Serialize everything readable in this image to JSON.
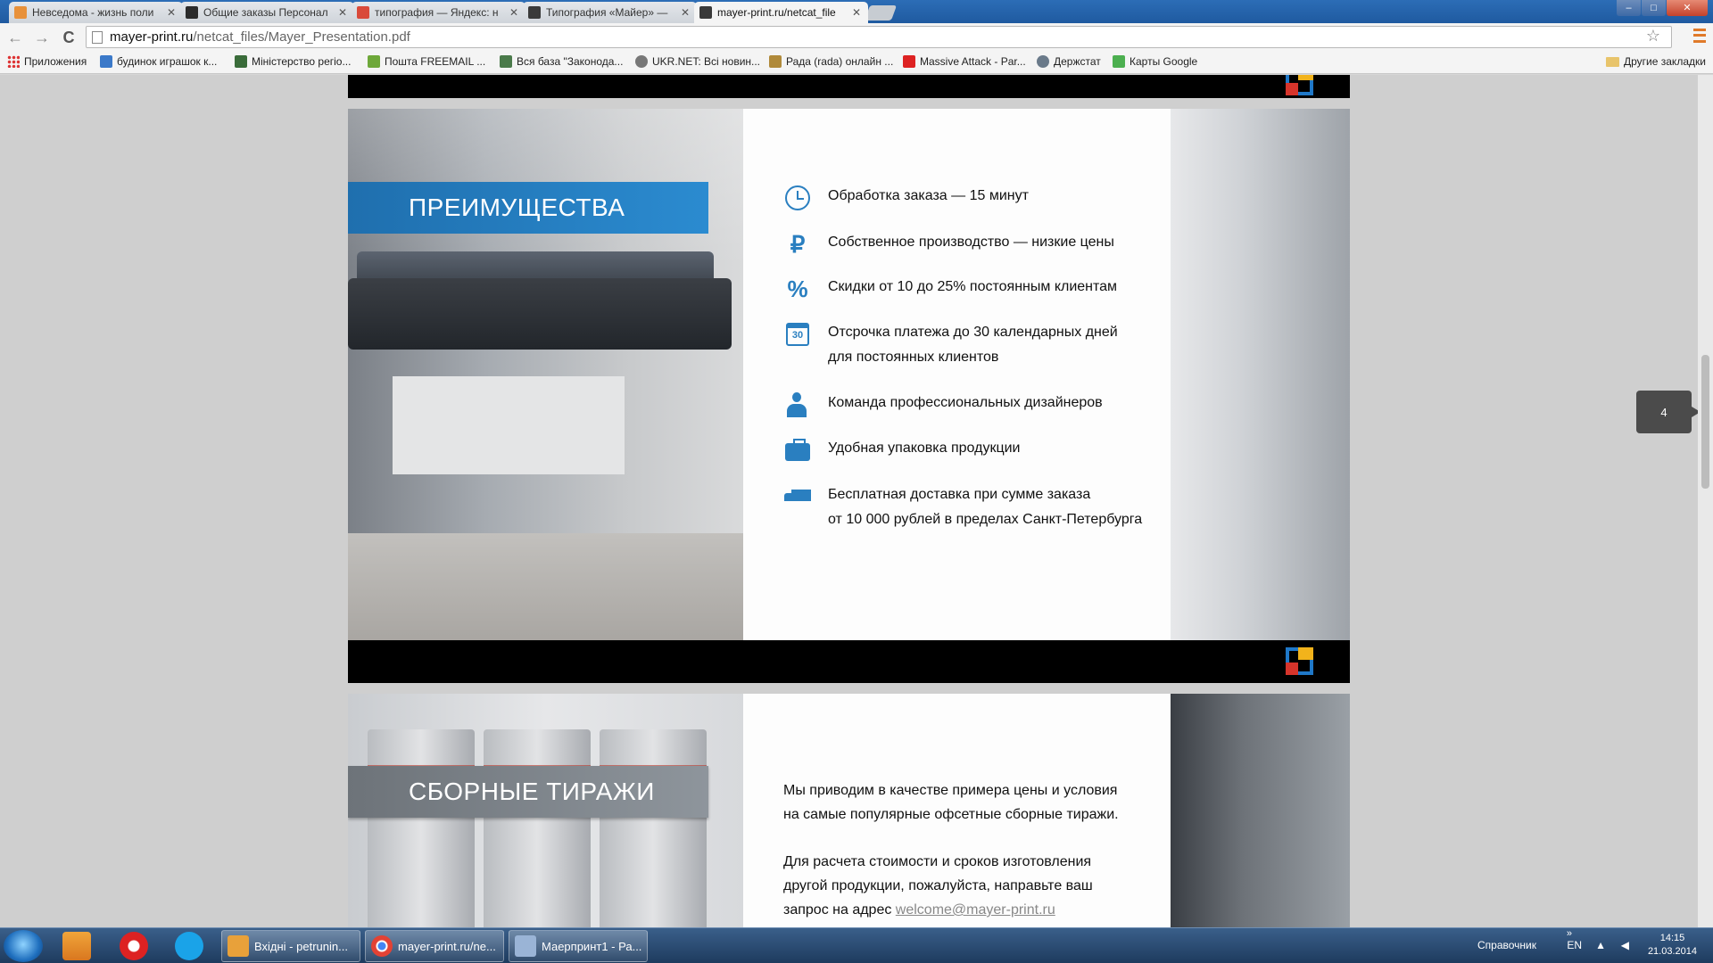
{
  "tabs": [
    {
      "title": "Невседома - жизнь поли",
      "color": "#e8913a"
    },
    {
      "title": "Общие заказы Персонал",
      "color": "#2b2b2b"
    },
    {
      "title": "типография — Яндекс: н",
      "color": "#d94a3a"
    },
    {
      "title": "Типография «Майер» —",
      "color": "#3a3a3a"
    },
    {
      "title": "mayer-print.ru/netcat_file",
      "color": "#3a3a3a"
    }
  ],
  "window_controls": {
    "minimize": "–",
    "maximize": "□",
    "close": "✕"
  },
  "address": {
    "host": "mayer-print.ru",
    "path": "/netcat_files/Mayer_Presentation.pdf"
  },
  "nav": {
    "back": "←",
    "forward": "→",
    "reload": "C"
  },
  "bookmarks": [
    {
      "label": "Приложения",
      "color": "#d33"
    },
    {
      "label": "будинок играшок к...",
      "color": "#3b79c9"
    },
    {
      "label": "Міністерство регіо...",
      "color": "#3a6c3a"
    },
    {
      "label": "Пошта FREEMAIL ...",
      "color": "#6ea83a"
    },
    {
      "label": "Вся база \"Законода...",
      "color": "#4a7a4a"
    },
    {
      "label": "UKR.NET: Всі новин...",
      "color": "#777"
    },
    {
      "label": "Рада (rada) онлайн ...",
      "color": "#b08a3a"
    },
    {
      "label": "Massive Attack - Par...",
      "color": "#d22"
    },
    {
      "label": "Держстат",
      "color": "#6a7a8a"
    },
    {
      "label": "Карты Google",
      "color": "#4caf50"
    }
  ],
  "other_bookmarks": "Другие закладки",
  "slide1": {
    "heading": "ПРЕИМУЩЕСТВА",
    "items": [
      {
        "icon": "clock-icon",
        "text": "Обработка заказа — 15 минут",
        "text2": ""
      },
      {
        "icon": "ruble-icon",
        "glyph": "₽",
        "text": "Собственное производство — низкие цены",
        "text2": ""
      },
      {
        "icon": "percent-icon",
        "glyph": "%",
        "text": "Скидки от 10 до 25% постоянным клиентам",
        "text2": ""
      },
      {
        "icon": "calendar-icon",
        "glyph": "30",
        "text": "Отсрочка платежа до 30 календарных дней",
        "text2": "для постоянных клиентов"
      },
      {
        "icon": "person-icon",
        "text": "Команда профессиональных дизайнеров",
        "text2": ""
      },
      {
        "icon": "briefcase-icon",
        "text": "Удобная упаковка продукции",
        "text2": ""
      },
      {
        "icon": "truck-icon",
        "text": "Бесплатная доставка при сумме заказа",
        "text2": "от 10 000 рублей в пределах Санкт-Петербурга"
      }
    ]
  },
  "slide2": {
    "heading": "СБОРНЫЕ ТИРАЖИ",
    "para1_line1": "Мы приводим в качестве примера цены и условия",
    "para1_line2": "на самые популярные офсетные сборные тиражи.",
    "para2_line1": "Для расчета стоимости и сроков изготовления",
    "para2_line2": "другой продукции, пожалуйста, направьте ваш",
    "para2_line3_prefix": "запрос на адрес ",
    "email": "welcome@mayer-print.ru"
  },
  "page_number": "4",
  "taskbar": {
    "tasks": [
      {
        "label": "Вхідні - petrunin...",
        "color": "#e8a13a"
      },
      {
        "label": "mayer-print.ru/ne...",
        "color": "#e34234"
      },
      {
        "label": "Маерпринт1 - Ра...",
        "color": "#9ab4d6"
      }
    ],
    "toolbar_label": "Справочник",
    "language": "EN",
    "time": "14:15",
    "date": "21.03.2014"
  }
}
